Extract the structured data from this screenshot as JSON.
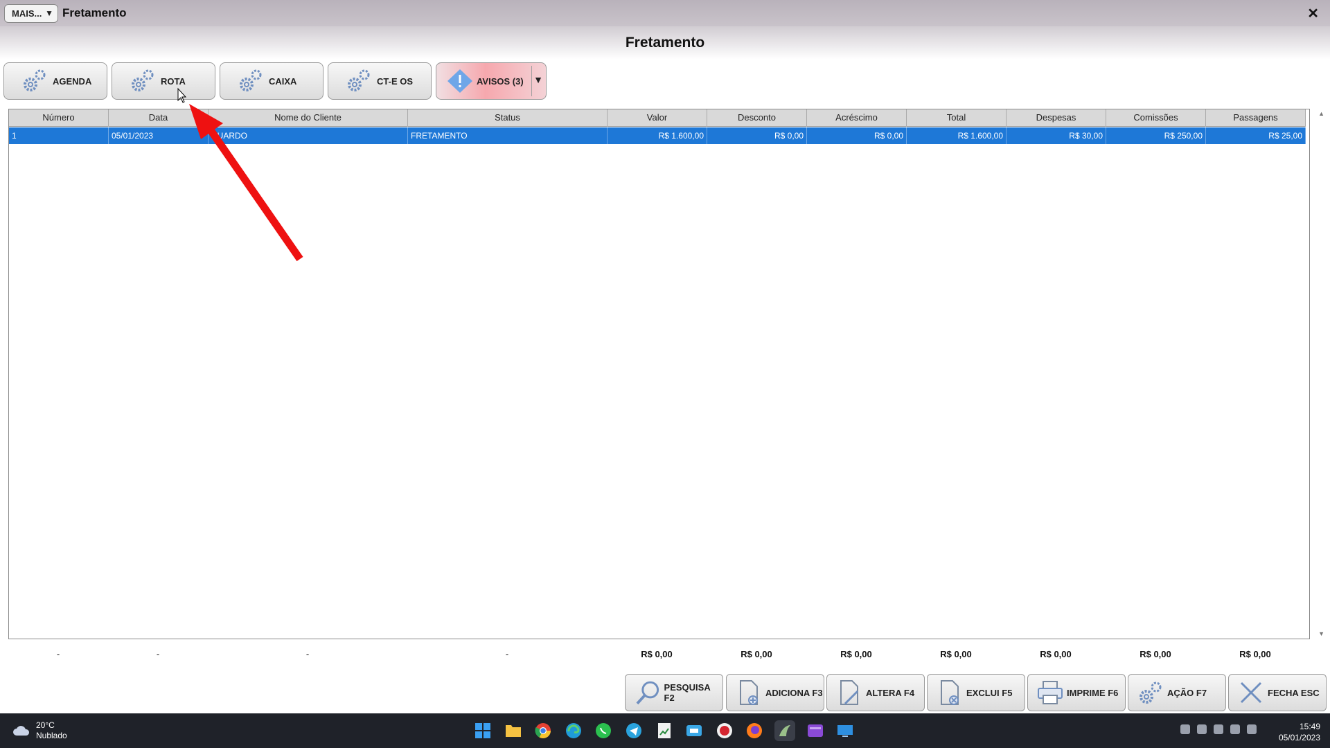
{
  "window": {
    "more_button": "MAIS...",
    "more_arrow": "▼",
    "title": "Fretamento",
    "close_glyph": "✕"
  },
  "page_title": "Fretamento",
  "toolbar": {
    "agenda": "AGENDA",
    "rota": "ROTA",
    "caixa": "CAIXA",
    "cte_os": "CT-E OS",
    "avisos": "AVISOS (3)",
    "avisos_arrow": "▼"
  },
  "table": {
    "columns": [
      "Número",
      "Data",
      "Nome do Cliente",
      "Status",
      "Valor",
      "Desconto",
      "Acréscimo",
      "Total",
      "Despesas",
      "Comissões",
      "Passagens"
    ],
    "rows": [
      [
        "1",
        "05/01/2023",
        "DUARDO",
        "FRETAMENTO",
        "R$ 1.600,00",
        "R$ 0,00",
        "R$ 0,00",
        "R$ 1.600,00",
        "R$ 30,00",
        "R$ 250,00",
        "R$ 25,00"
      ]
    ],
    "selected_row": 0
  },
  "totals": [
    "-",
    "-",
    "-",
    "-",
    "R$ 0,00",
    "R$ 0,00",
    "R$ 0,00",
    "R$ 0,00",
    "R$ 0,00",
    "R$ 0,00",
    "R$ 0,00"
  ],
  "actions": {
    "pesquisa": "PESQUISA F2",
    "adiciona": "ADICIONA F3",
    "altera": "ALTERA F4",
    "exclui": "EXCLUI F5",
    "imprime": "IMPRIME F6",
    "acao": "AÇÃO F7",
    "fecha": "FECHA ESC"
  },
  "taskbar": {
    "temperature": "20°C",
    "weather": "Nublado",
    "time": "15:49",
    "date": "05/01/2023"
  },
  "colors": {
    "selection": "#1e78d7",
    "annotation_arrow": "#ee1111",
    "taskbar": "#1f2229"
  }
}
